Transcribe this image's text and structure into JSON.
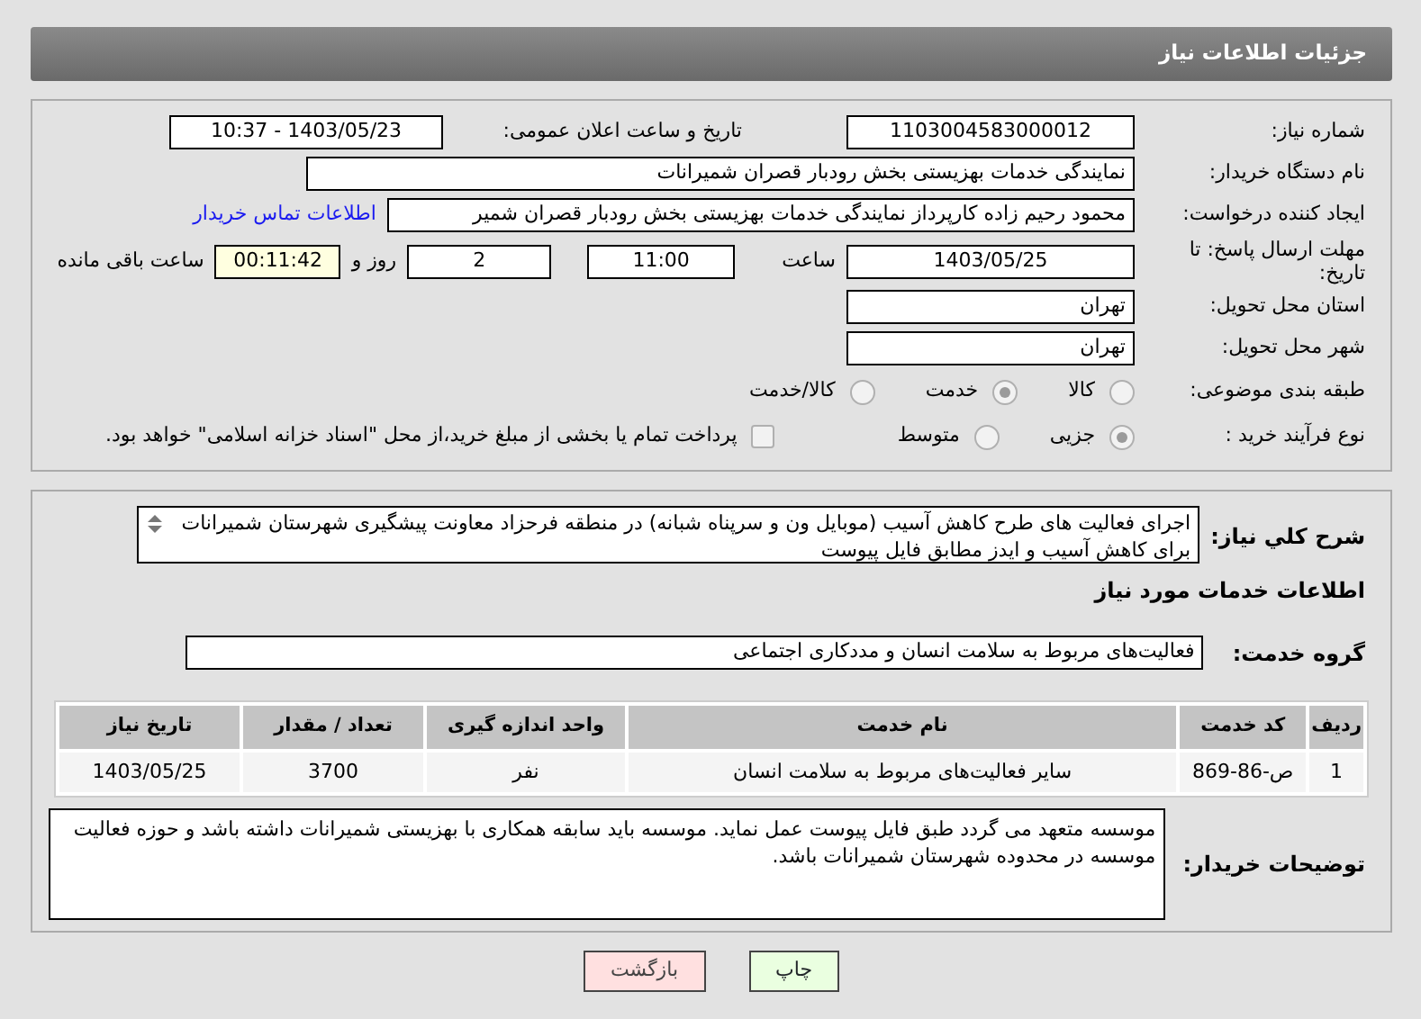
{
  "header": {
    "title": "جزئیات اطلاعات نیاز"
  },
  "info": {
    "need_number": {
      "label": "شماره نیاز:",
      "value": "1103004583000012"
    },
    "announce": {
      "label": "تاریخ و ساعت اعلان عمومی:",
      "value": "1403/05/23 - 10:37"
    },
    "buyer": {
      "label": "نام دستگاه خریدار:",
      "value": "نمایندگی خدمات بهزیستی بخش رودبار قصران   شمیرانات"
    },
    "creator": {
      "label": "ایجاد کننده درخواست:",
      "value": "محمود رحیم زاده کارپرداز نمایندگی خدمات بهزیستی بخش رودبار قصران   شمیر",
      "link": "اطلاعات تماس خریدار"
    },
    "deadline": {
      "label": "مهلت ارسال پاسخ: تا تاریخ:",
      "date": "1403/05/25",
      "time_label": "ساعت",
      "time": "11:00",
      "days": "2",
      "days_label": "روز و",
      "remaining": "00:11:42",
      "remaining_label": "ساعت باقی مانده"
    },
    "province": {
      "label": "استان محل تحویل:",
      "value": "تهران"
    },
    "city": {
      "label": "شهر محل تحویل:",
      "value": "تهران"
    },
    "category": {
      "label": "طبقه بندی موضوعی:",
      "options": [
        {
          "label": "کالا",
          "selected": false
        },
        {
          "label": "خدمت",
          "selected": true
        },
        {
          "label": "کالا/خدمت",
          "selected": false
        }
      ]
    },
    "process": {
      "label": "نوع فرآیند خرید :",
      "options": [
        {
          "label": "جزیی",
          "selected": true
        },
        {
          "label": "متوسط",
          "selected": false
        }
      ],
      "payment": {
        "label": "پرداخت تمام یا بخشی از مبلغ خرید،از محل \"اسناد خزانه اسلامی\" خواهد بود.",
        "checked": false
      }
    }
  },
  "details": {
    "summary_label": "شرح کلي نياز:",
    "summary": "اجرای فعالیت های طرح کاهش آسیب (موبایل ون و سرپناه شبانه) در منطقه فرحزاد معاونت پیشگیری شهرستان شمیرانات برای کاهش آسیب و ایدز مطابق فایل پیوست",
    "services_title": "اطلاعات خدمات مورد نیاز",
    "group_label": "گروه خدمت:",
    "group": "فعالیت‌های مربوط به سلامت انسان و مددکاری اجتماعی",
    "table": {
      "columns": [
        "ردیف",
        "کد خدمت",
        "نام خدمت",
        "واحد اندازه گیری",
        "تعداد / مقدار",
        "تاریخ نیاز"
      ],
      "rows": [
        [
          "1",
          "ص-86-869",
          "سایر فعالیت‌های مربوط به سلامت انسان",
          "نفر",
          "3700",
          "1403/05/25"
        ]
      ]
    },
    "notes_label": "توضیحات خریدار:",
    "notes": "موسسه متعهد می گردد طبق فایل پیوست عمل نماید. موسسه باید سابقه همکاری با بهزیستی شمیرانات داشته باشد و حوزه فعالیت موسسه در محدوده شهرستان شمیرانات باشد."
  },
  "buttons": {
    "print": "چاپ",
    "back": "بازگشت"
  }
}
